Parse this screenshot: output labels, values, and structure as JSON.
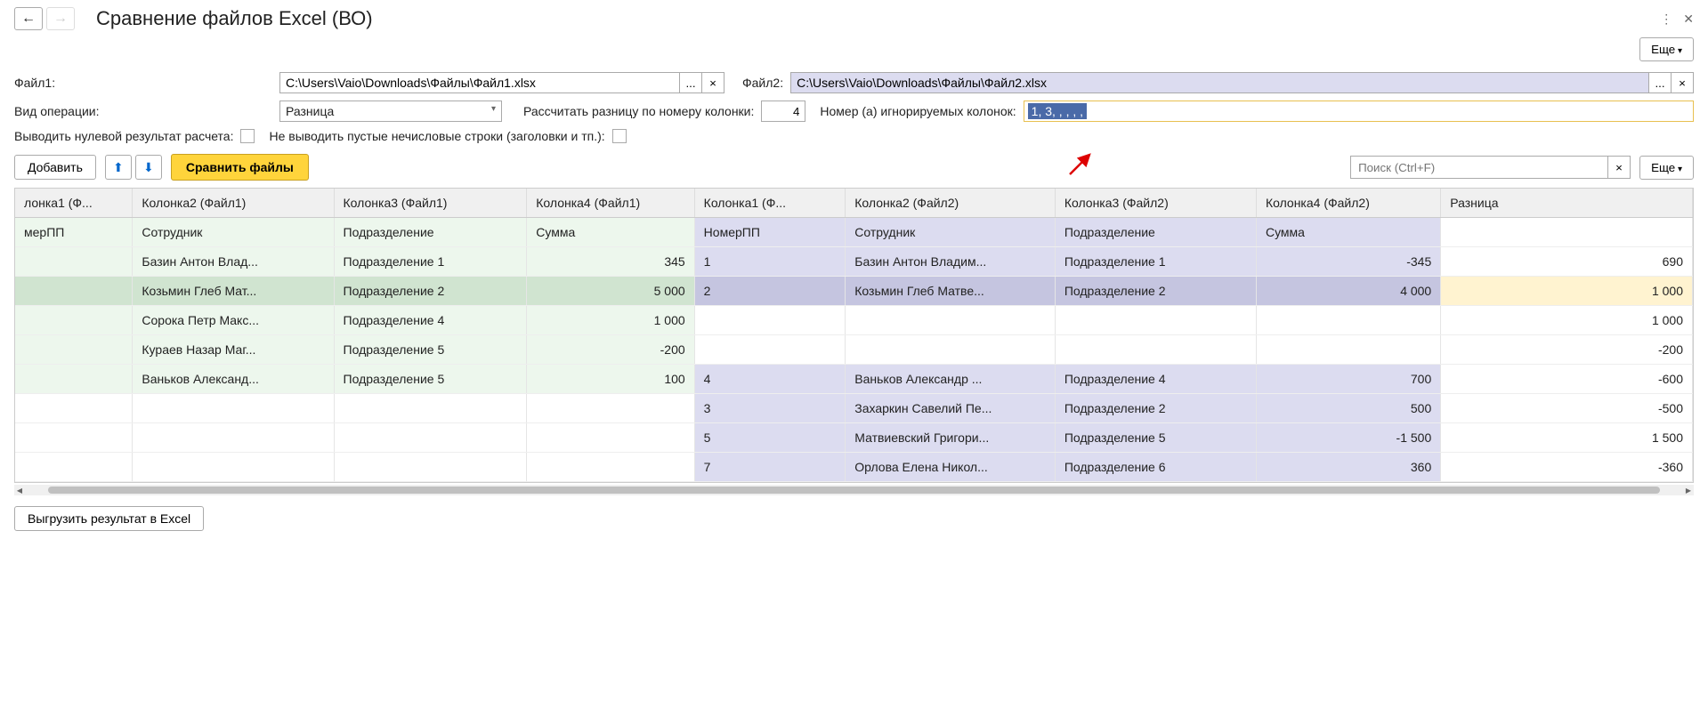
{
  "title": "Сравнение файлов Excel (ВО)",
  "more_label": "Еще",
  "file1_label": "Файл1:",
  "file1_path": "C:\\Users\\Vaio\\Downloads\\Файлы\\Файл1.xlsx",
  "file2_label": "Файл2:",
  "file2_path": "C:\\Users\\Vaio\\Downloads\\Файлы\\Файл2.xlsx",
  "operation_label": "Вид операции:",
  "operation_value": "Разница",
  "calc_label": "Рассчитать разницу по номеру колонки:",
  "calc_value": "4",
  "ignore_label": "Номер (а) игнорируемых колонок:",
  "ignore_value": "1, 3, , , , ,",
  "zero_result_label": "Выводить нулевой результат расчета:",
  "empty_rows_label": "Не выводить пустые нечисловые строки (заголовки и тп.):",
  "add_btn": "Добавить",
  "compare_btn": "Сравнить файлы",
  "search_placeholder": "Поиск (Ctrl+F)",
  "export_btn": "Выгрузить результат в Excel",
  "columns": {
    "a1": "лонка1 (Ф...",
    "a2": "Колонка2 (Файл1)",
    "a3": "Колонка3 (Файл1)",
    "a4": "Колонка4 (Файл1)",
    "b1": "Колонка1 (Ф...",
    "b2": "Колонка2 (Файл2)",
    "b3": "Колонка3 (Файл2)",
    "b4": "Колонка4 (Файл2)",
    "diff": "Разница"
  },
  "rows": [
    {
      "a1": "мерПП",
      "a2": "Сотрудник",
      "a3": "Подразделение",
      "a4": "Сумма",
      "b1": "НомерПП",
      "b2": "Сотрудник",
      "b3": "Подразделение",
      "b4": "Сумма",
      "diff": "",
      "style": "header"
    },
    {
      "a1": "",
      "a2": "Базин Антон Влад...",
      "a3": "Подразделение 1",
      "a4": "345",
      "b1": "1",
      "b2": "Базин Антон Владим...",
      "b3": "Подразделение 1",
      "b4": "-345",
      "diff": "690",
      "style": "normal"
    },
    {
      "a1": "",
      "a2": "Козьмин Глеб Мат...",
      "a3": "Подразделение 2",
      "a4": "5 000",
      "b1": "2",
      "b2": "Козьмин Глеб Матве...",
      "b3": "Подразделение 2",
      "b4": "4 000",
      "diff": "1 000",
      "style": "selected"
    },
    {
      "a1": "",
      "a2": "Сорока Петр Макс...",
      "a3": "Подразделение 4",
      "a4": "1 000",
      "b1": "",
      "b2": "",
      "b3": "",
      "b4": "",
      "diff": "1 000",
      "style": "left-only"
    },
    {
      "a1": "",
      "a2": "Кураев Назар Маг...",
      "a3": "Подразделение 5",
      "a4": "-200",
      "b1": "",
      "b2": "",
      "b3": "",
      "b4": "",
      "diff": "-200",
      "style": "left-only"
    },
    {
      "a1": "",
      "a2": "Ваньков Александ...",
      "a3": "Подразделение 5",
      "a4": "100",
      "b1": "4",
      "b2": "Ваньков Александр ...",
      "b3": "Подразделение 4",
      "b4": "700",
      "diff": "-600",
      "style": "normal"
    },
    {
      "a1": "",
      "a2": "",
      "a3": "",
      "a4": "",
      "b1": "3",
      "b2": "Захаркин Савелий Пе...",
      "b3": "Подразделение 2",
      "b4": "500",
      "diff": "-500",
      "style": "right-only"
    },
    {
      "a1": "",
      "a2": "",
      "a3": "",
      "a4": "",
      "b1": "5",
      "b2": "Матвиевский Григори...",
      "b3": "Подразделение 5",
      "b4": "-1 500",
      "diff": "1 500",
      "style": "right-only"
    },
    {
      "a1": "",
      "a2": "",
      "a3": "",
      "a4": "",
      "b1": "7",
      "b2": "Орлова Елена Никол...",
      "b3": "Подразделение 6",
      "b4": "360",
      "diff": "-360",
      "style": "right-only"
    }
  ]
}
